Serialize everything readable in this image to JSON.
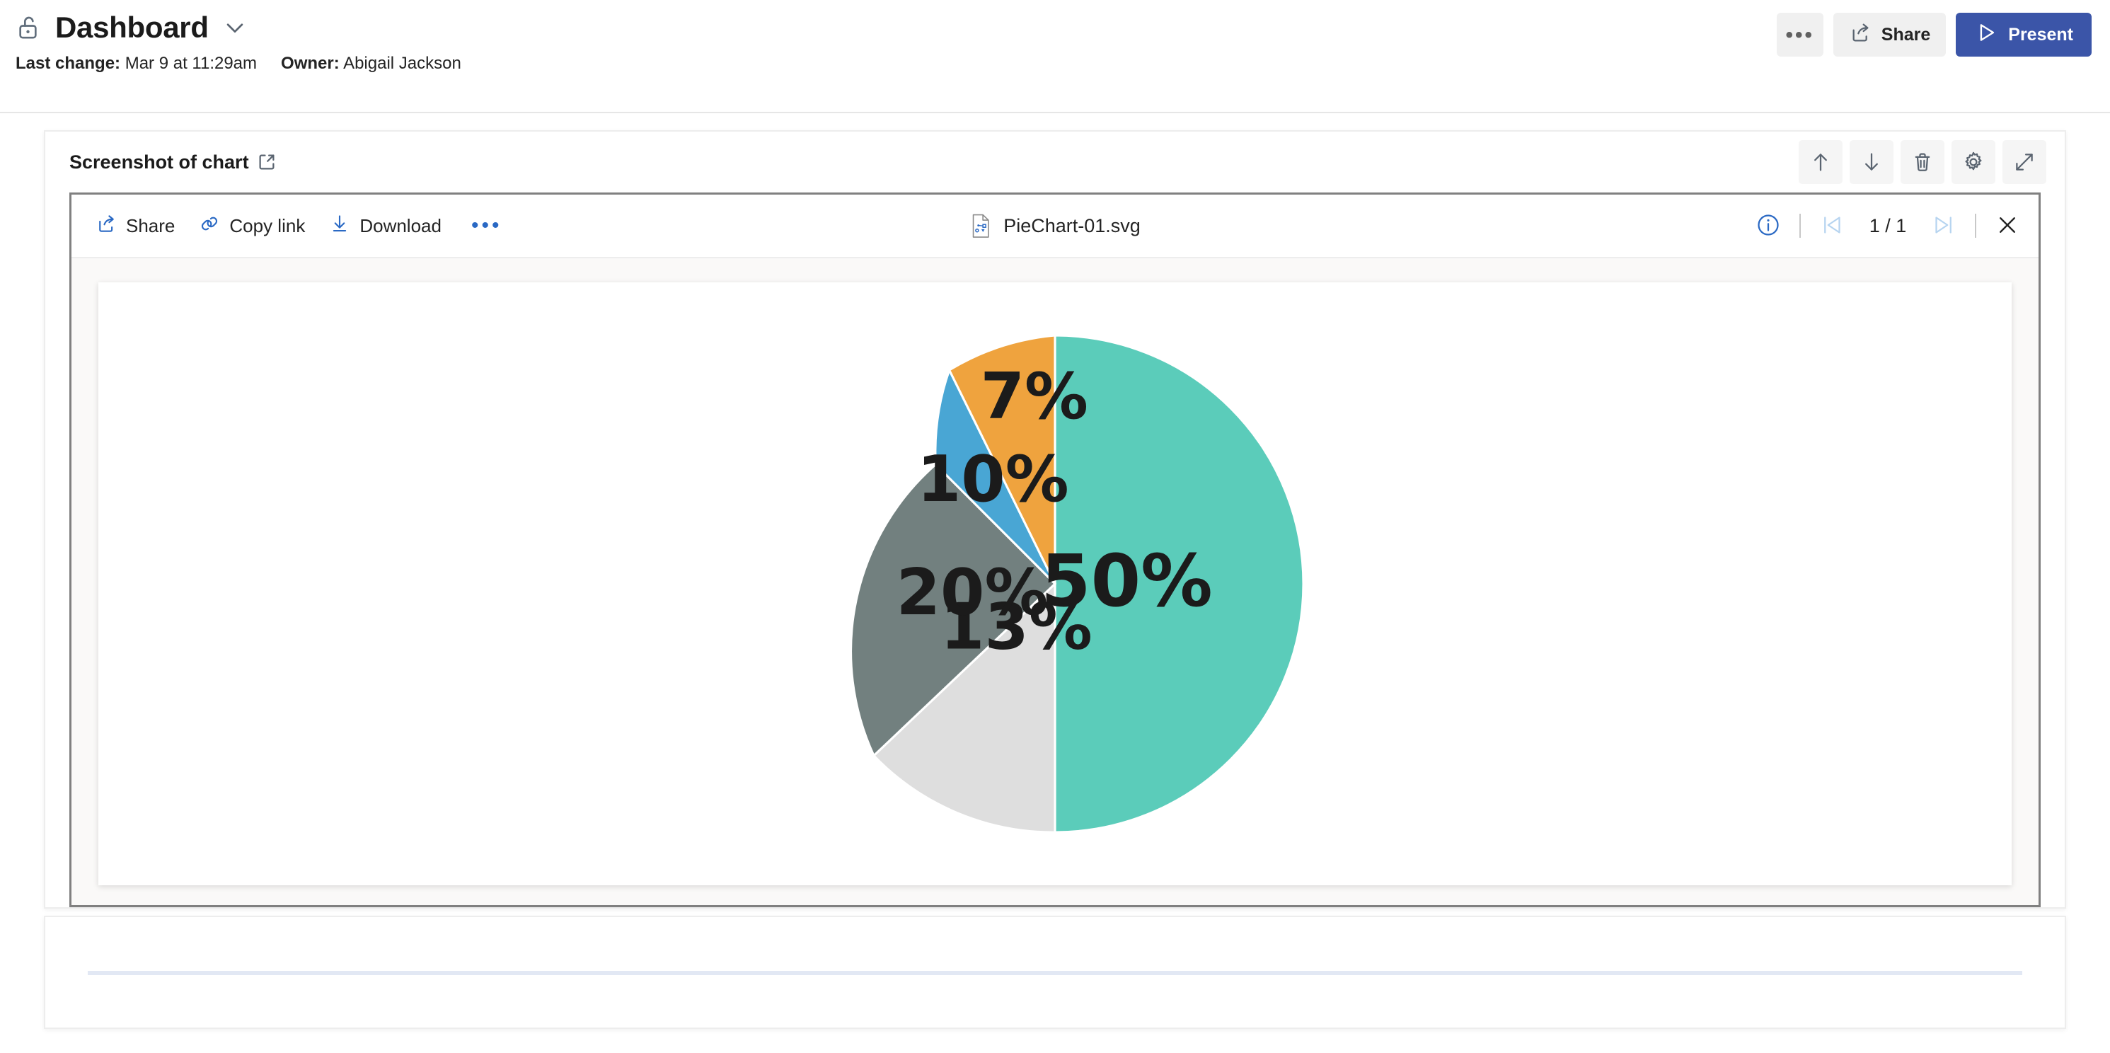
{
  "header": {
    "lock_icon": "unlock-icon",
    "title": "Dashboard",
    "chevron_icon": "chevron-down-icon",
    "meta": {
      "last_change_label": "Last change:",
      "last_change_value": "Mar 9 at 11:29am",
      "owner_label": "Owner:",
      "owner_value": "Abigail Jackson"
    },
    "actions": {
      "more_icon": "more-horizontal-icon",
      "share_label": "Share",
      "share_icon": "share-icon",
      "present_label": "Present",
      "present_icon": "play-triangle-icon"
    }
  },
  "card": {
    "title": "Screenshot of chart",
    "title_icon": "external-link-icon",
    "tools": [
      {
        "name": "move-up-button",
        "icon": "arrow-up-icon"
      },
      {
        "name": "move-down-button",
        "icon": "arrow-down-icon"
      },
      {
        "name": "delete-button",
        "icon": "trash-icon"
      },
      {
        "name": "settings-button",
        "icon": "gear-icon"
      },
      {
        "name": "expand-button",
        "icon": "expand-diagonal-icon"
      }
    ]
  },
  "viewer": {
    "commands": [
      {
        "name": "share-command",
        "label": "Share",
        "icon": "share-icon"
      },
      {
        "name": "copy-link-command",
        "label": "Copy link",
        "icon": "link-icon"
      },
      {
        "name": "download-command",
        "label": "Download",
        "icon": "download-icon"
      }
    ],
    "overflow_icon": "more-horizontal-icon",
    "file_name": "PieChart-01.svg",
    "file_icon": "svg-file-icon",
    "info_icon": "info-circle-icon",
    "prev_icon": "previous-page-icon",
    "next_icon": "next-page-icon",
    "page_indicator": "1 / 1",
    "close_icon": "close-icon"
  },
  "colors": {
    "accent_blue": "#2a69c4",
    "present_blue": "#3b55a8",
    "teal": "#5bccba",
    "light_gray": "#dedede",
    "dark_gray": "#72807f",
    "blue": "#49a6d4",
    "orange": "#efa33e"
  },
  "chart_data": {
    "type": "pie",
    "title": "",
    "labels": [
      "50%",
      "13%",
      "20%",
      "10%",
      "7%"
    ],
    "values": [
      50,
      13,
      20,
      10,
      7
    ],
    "colors": [
      "#5bccba",
      "#dedede",
      "#72807f",
      "#49a6d4",
      "#efa33e"
    ],
    "start_angle_deg": 0,
    "direction": "clockwise",
    "slice_separator_color": "#ffffff",
    "legend": "none",
    "data_labels_inside": true
  }
}
